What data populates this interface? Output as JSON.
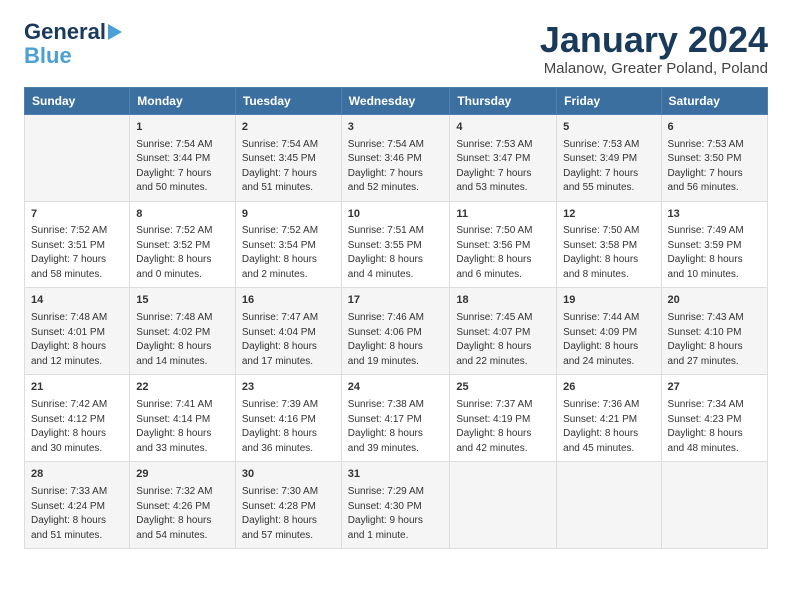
{
  "logo": {
    "line1": "General",
    "line2": "Blue"
  },
  "title": "January 2024",
  "subtitle": "Malanow, Greater Poland, Poland",
  "days_header": [
    "Sunday",
    "Monday",
    "Tuesday",
    "Wednesday",
    "Thursday",
    "Friday",
    "Saturday"
  ],
  "weeks": [
    [
      {
        "day": "",
        "data": ""
      },
      {
        "day": "1",
        "data": "Sunrise: 7:54 AM\nSunset: 3:44 PM\nDaylight: 7 hours\nand 50 minutes."
      },
      {
        "day": "2",
        "data": "Sunrise: 7:54 AM\nSunset: 3:45 PM\nDaylight: 7 hours\nand 51 minutes."
      },
      {
        "day": "3",
        "data": "Sunrise: 7:54 AM\nSunset: 3:46 PM\nDaylight: 7 hours\nand 52 minutes."
      },
      {
        "day": "4",
        "data": "Sunrise: 7:53 AM\nSunset: 3:47 PM\nDaylight: 7 hours\nand 53 minutes."
      },
      {
        "day": "5",
        "data": "Sunrise: 7:53 AM\nSunset: 3:49 PM\nDaylight: 7 hours\nand 55 minutes."
      },
      {
        "day": "6",
        "data": "Sunrise: 7:53 AM\nSunset: 3:50 PM\nDaylight: 7 hours\nand 56 minutes."
      }
    ],
    [
      {
        "day": "7",
        "data": "Sunrise: 7:52 AM\nSunset: 3:51 PM\nDaylight: 7 hours\nand 58 minutes."
      },
      {
        "day": "8",
        "data": "Sunrise: 7:52 AM\nSunset: 3:52 PM\nDaylight: 8 hours\nand 0 minutes."
      },
      {
        "day": "9",
        "data": "Sunrise: 7:52 AM\nSunset: 3:54 PM\nDaylight: 8 hours\nand 2 minutes."
      },
      {
        "day": "10",
        "data": "Sunrise: 7:51 AM\nSunset: 3:55 PM\nDaylight: 8 hours\nand 4 minutes."
      },
      {
        "day": "11",
        "data": "Sunrise: 7:50 AM\nSunset: 3:56 PM\nDaylight: 8 hours\nand 6 minutes."
      },
      {
        "day": "12",
        "data": "Sunrise: 7:50 AM\nSunset: 3:58 PM\nDaylight: 8 hours\nand 8 minutes."
      },
      {
        "day": "13",
        "data": "Sunrise: 7:49 AM\nSunset: 3:59 PM\nDaylight: 8 hours\nand 10 minutes."
      }
    ],
    [
      {
        "day": "14",
        "data": "Sunrise: 7:48 AM\nSunset: 4:01 PM\nDaylight: 8 hours\nand 12 minutes."
      },
      {
        "day": "15",
        "data": "Sunrise: 7:48 AM\nSunset: 4:02 PM\nDaylight: 8 hours\nand 14 minutes."
      },
      {
        "day": "16",
        "data": "Sunrise: 7:47 AM\nSunset: 4:04 PM\nDaylight: 8 hours\nand 17 minutes."
      },
      {
        "day": "17",
        "data": "Sunrise: 7:46 AM\nSunset: 4:06 PM\nDaylight: 8 hours\nand 19 minutes."
      },
      {
        "day": "18",
        "data": "Sunrise: 7:45 AM\nSunset: 4:07 PM\nDaylight: 8 hours\nand 22 minutes."
      },
      {
        "day": "19",
        "data": "Sunrise: 7:44 AM\nSunset: 4:09 PM\nDaylight: 8 hours\nand 24 minutes."
      },
      {
        "day": "20",
        "data": "Sunrise: 7:43 AM\nSunset: 4:10 PM\nDaylight: 8 hours\nand 27 minutes."
      }
    ],
    [
      {
        "day": "21",
        "data": "Sunrise: 7:42 AM\nSunset: 4:12 PM\nDaylight: 8 hours\nand 30 minutes."
      },
      {
        "day": "22",
        "data": "Sunrise: 7:41 AM\nSunset: 4:14 PM\nDaylight: 8 hours\nand 33 minutes."
      },
      {
        "day": "23",
        "data": "Sunrise: 7:39 AM\nSunset: 4:16 PM\nDaylight: 8 hours\nand 36 minutes."
      },
      {
        "day": "24",
        "data": "Sunrise: 7:38 AM\nSunset: 4:17 PM\nDaylight: 8 hours\nand 39 minutes."
      },
      {
        "day": "25",
        "data": "Sunrise: 7:37 AM\nSunset: 4:19 PM\nDaylight: 8 hours\nand 42 minutes."
      },
      {
        "day": "26",
        "data": "Sunrise: 7:36 AM\nSunset: 4:21 PM\nDaylight: 8 hours\nand 45 minutes."
      },
      {
        "day": "27",
        "data": "Sunrise: 7:34 AM\nSunset: 4:23 PM\nDaylight: 8 hours\nand 48 minutes."
      }
    ],
    [
      {
        "day": "28",
        "data": "Sunrise: 7:33 AM\nSunset: 4:24 PM\nDaylight: 8 hours\nand 51 minutes."
      },
      {
        "day": "29",
        "data": "Sunrise: 7:32 AM\nSunset: 4:26 PM\nDaylight: 8 hours\nand 54 minutes."
      },
      {
        "day": "30",
        "data": "Sunrise: 7:30 AM\nSunset: 4:28 PM\nDaylight: 8 hours\nand 57 minutes."
      },
      {
        "day": "31",
        "data": "Sunrise: 7:29 AM\nSunset: 4:30 PM\nDaylight: 9 hours\nand 1 minute."
      },
      {
        "day": "",
        "data": ""
      },
      {
        "day": "",
        "data": ""
      },
      {
        "day": "",
        "data": ""
      }
    ]
  ]
}
